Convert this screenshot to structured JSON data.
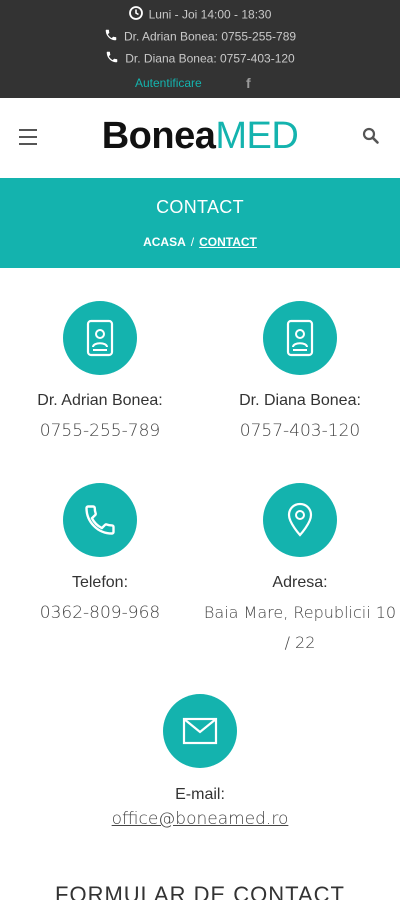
{
  "topbar": {
    "hours": "Luni - Joi 14:00 - 18:30",
    "phone1": "Dr. Adrian Bonea: 0755-255-789",
    "phone2": "Dr. Diana Bonea: 0757-403-120",
    "login": "Autentificare",
    "social_icon": "f"
  },
  "header": {
    "logo_part1": "Bonea",
    "logo_part2": "MED"
  },
  "banner": {
    "title": "CONTACT",
    "crumb_home": "ACASA",
    "crumb_sep": "/",
    "crumb_current": "CONTACT"
  },
  "contacts": [
    {
      "icon": "mobile-contact-icon",
      "label": "Dr. Adrian Bonea:",
      "value": "0755-255-789"
    },
    {
      "icon": "mobile-contact-icon",
      "label": "Dr. Diana Bonea:",
      "value": "0757-403-120"
    },
    {
      "icon": "phone-icon",
      "label": "Telefon:",
      "value": "0362-809-968"
    },
    {
      "icon": "location-pin-icon",
      "label": "Adresa:",
      "value": "Baia Mare, Republicii 10 / 22"
    },
    {
      "icon": "mail-icon",
      "label": "E-mail:",
      "value": "office@boneamed.ro"
    }
  ],
  "form": {
    "title": "FORMULAR DE CONTACT"
  },
  "colors": {
    "accent": "#14b3ae",
    "topbar": "#333333"
  }
}
